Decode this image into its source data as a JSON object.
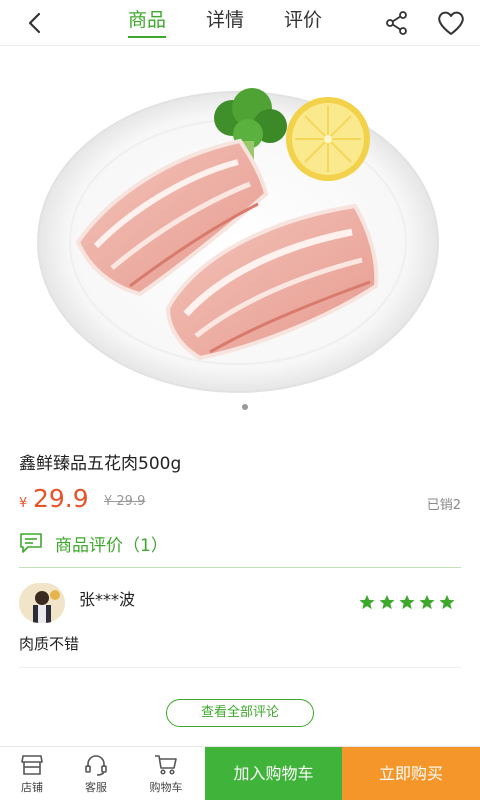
{
  "header": {
    "tabs": [
      {
        "label": "商品",
        "active": true
      },
      {
        "label": "详情",
        "active": false
      },
      {
        "label": "评价",
        "active": false
      }
    ],
    "accent_color": "#3ea82c"
  },
  "product": {
    "title": "鑫鲜臻品五花肉500g",
    "currency": "¥",
    "price": "29.9",
    "original_price": "¥ 29.9",
    "sold": "已销2",
    "price_color": "#e8542a",
    "image_count": 1
  },
  "reviews": {
    "header_label": "商品评价（1）",
    "items": [
      {
        "reviewer": "张***波",
        "rating": 5,
        "text": "肉质不错"
      }
    ],
    "all_button": "查看全部评论"
  },
  "bottom_bar": {
    "store_label": "店铺",
    "service_label": "客服",
    "cart_label": "购物车",
    "add_to_cart": "加入购物车",
    "buy_now": "立即购买",
    "add_to_cart_color": "#3fb33a",
    "buy_now_color": "#f5962a"
  }
}
